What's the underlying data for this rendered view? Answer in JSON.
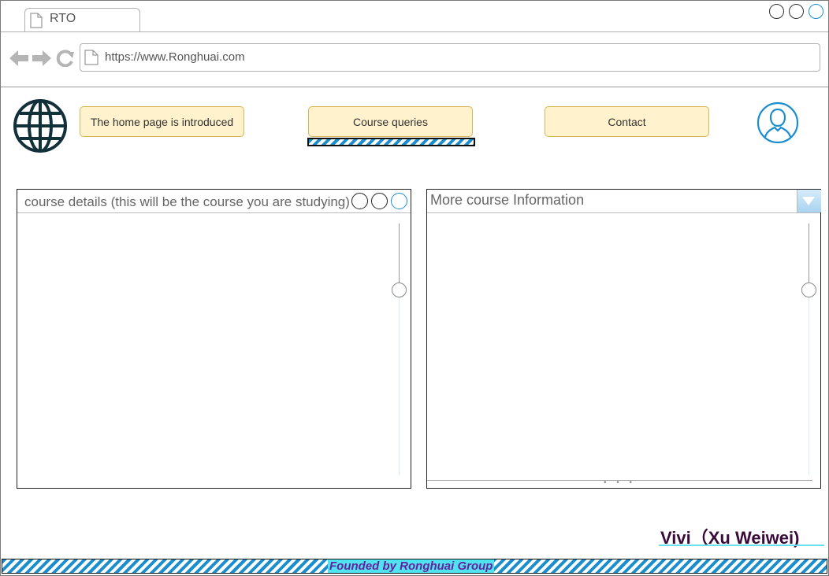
{
  "browser": {
    "tab_title": "RTO",
    "url": "https://www.Ronghuai.com"
  },
  "nav": {
    "items": [
      {
        "label": "The home page is introduced"
      },
      {
        "label": "Course queries"
      },
      {
        "label": "Contact"
      }
    ]
  },
  "panels": {
    "left_title": "course details (this will be the course you are studying)",
    "right_title": "More course Information"
  },
  "signature": "Vivi（Xu Weiwei)",
  "footer": {
    "text": "Founded by Ronghuai Group"
  },
  "colors": {
    "button_fill": "#fff2cc",
    "button_border": "#d6b656",
    "accent_blue": "#1a8ecf",
    "footer_highlight": "#4ee3ef"
  },
  "icons": {
    "logo": "globe-icon",
    "user": "user-avatar-icon",
    "back": "back-arrow-icon",
    "forward": "forward-arrow-icon",
    "reload": "reload-icon"
  }
}
